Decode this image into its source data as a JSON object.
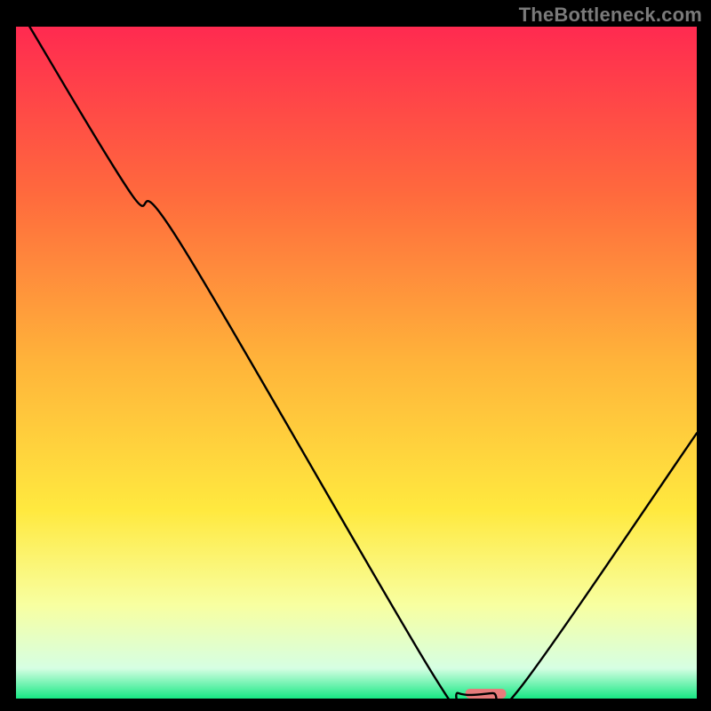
{
  "watermark": "TheBottleneck.com",
  "chart_data": {
    "type": "line",
    "title": "",
    "xlabel": "",
    "ylabel": "",
    "xlim": [
      0,
      100
    ],
    "ylim": [
      0,
      100
    ],
    "gradient_stops": [
      {
        "offset": 0.0,
        "color": "#ff2a50"
      },
      {
        "offset": 0.25,
        "color": "#ff6a3d"
      },
      {
        "offset": 0.5,
        "color": "#ffb43a"
      },
      {
        "offset": 0.72,
        "color": "#ffe93f"
      },
      {
        "offset": 0.86,
        "color": "#f8ffa0"
      },
      {
        "offset": 0.955,
        "color": "#d6ffe3"
      },
      {
        "offset": 1.0,
        "color": "#17e884"
      }
    ],
    "curve": [
      {
        "x": 2.0,
        "y": 100.0
      },
      {
        "x": 17.0,
        "y": 75.0
      },
      {
        "x": 24.0,
        "y": 68.0
      },
      {
        "x": 61.0,
        "y": 4.0
      },
      {
        "x": 65.0,
        "y": 0.8
      },
      {
        "x": 70.0,
        "y": 0.8
      },
      {
        "x": 74.0,
        "y": 1.5
      },
      {
        "x": 100.0,
        "y": 39.5
      }
    ],
    "marker": {
      "x_start": 66.0,
      "x_end": 72.0,
      "y": 0.0,
      "color": "#e77b7b"
    }
  }
}
